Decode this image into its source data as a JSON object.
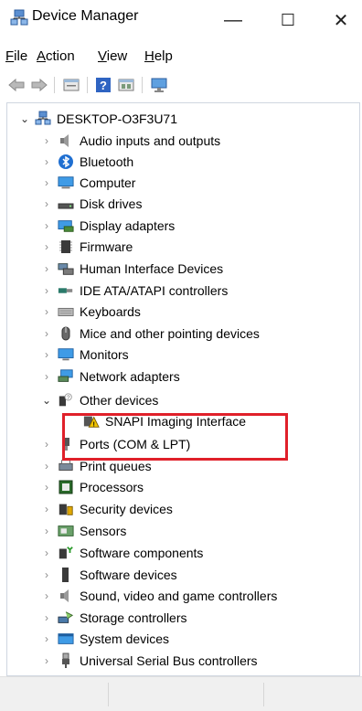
{
  "window": {
    "title": "Device Manager",
    "icon": "device-manager-icon",
    "controls": {
      "minimize": "—",
      "maximize": "☐",
      "close": "✕"
    }
  },
  "menu": [
    {
      "label": "File",
      "mnemonic": "F",
      "rest": "ile"
    },
    {
      "label": "Action",
      "mnemonic": "A",
      "rest": "ction"
    },
    {
      "label": "View",
      "mnemonic": "V",
      "rest": "iew"
    },
    {
      "label": "Help",
      "mnemonic": "H",
      "rest": "elp"
    }
  ],
  "toolbar": [
    "back-icon",
    "forward-icon",
    "properties-icon",
    "help-icon",
    "update-driver-icon",
    "monitor-icon"
  ],
  "tree": {
    "root": {
      "label": "DESKTOP-O3F3U71",
      "expanded": true,
      "icon": "computer-root-icon"
    },
    "categories": [
      {
        "label": "Audio inputs and outputs",
        "icon": "speaker-icon",
        "expanded": false
      },
      {
        "label": "Bluetooth",
        "icon": "bluetooth-icon",
        "expanded": false
      },
      {
        "label": "Computer",
        "icon": "computer-icon",
        "expanded": false
      },
      {
        "label": "Disk drives",
        "icon": "disk-drive-icon",
        "expanded": false
      },
      {
        "label": "Display adapters",
        "icon": "display-adapter-icon",
        "expanded": false
      },
      {
        "label": "Firmware",
        "icon": "firmware-icon",
        "expanded": false
      },
      {
        "label": "Human Interface Devices",
        "icon": "hid-icon",
        "expanded": false
      },
      {
        "label": "IDE ATA/ATAPI controllers",
        "icon": "ide-controller-icon",
        "expanded": false
      },
      {
        "label": "Keyboards",
        "icon": "keyboard-icon",
        "expanded": false
      },
      {
        "label": "Mice and other pointing devices",
        "icon": "mouse-icon",
        "expanded": false
      },
      {
        "label": "Monitors",
        "icon": "monitor-icon",
        "expanded": false
      },
      {
        "label": "Network adapters",
        "icon": "network-adapter-icon",
        "expanded": false
      },
      {
        "label": "Other devices",
        "icon": "unknown-device-icon",
        "expanded": true,
        "children": [
          {
            "label": "SNAPI Imaging Interface",
            "icon": "warning-device-icon"
          }
        ]
      },
      {
        "label": "Ports (COM & LPT)",
        "icon": "port-icon",
        "expanded": false
      },
      {
        "label": "Print queues",
        "icon": "printer-icon",
        "expanded": false
      },
      {
        "label": "Processors",
        "icon": "processor-icon",
        "expanded": false
      },
      {
        "label": "Security devices",
        "icon": "security-device-icon",
        "expanded": false
      },
      {
        "label": "Sensors",
        "icon": "sensor-icon",
        "expanded": false
      },
      {
        "label": "Software components",
        "icon": "software-component-icon",
        "expanded": false
      },
      {
        "label": "Software devices",
        "icon": "software-device-icon",
        "expanded": false
      },
      {
        "label": "Sound, video and game controllers",
        "icon": "sound-icon",
        "expanded": false
      },
      {
        "label": "Storage controllers",
        "icon": "storage-controller-icon",
        "expanded": false
      },
      {
        "label": "System devices",
        "icon": "system-device-icon",
        "expanded": false
      },
      {
        "label": "Universal Serial Bus controllers",
        "icon": "usb-icon",
        "expanded": false
      }
    ]
  },
  "colors": {
    "highlight_box": "#e0202a",
    "status_bar": "#f0f0f0",
    "panel_border": "#cfd6e0"
  }
}
